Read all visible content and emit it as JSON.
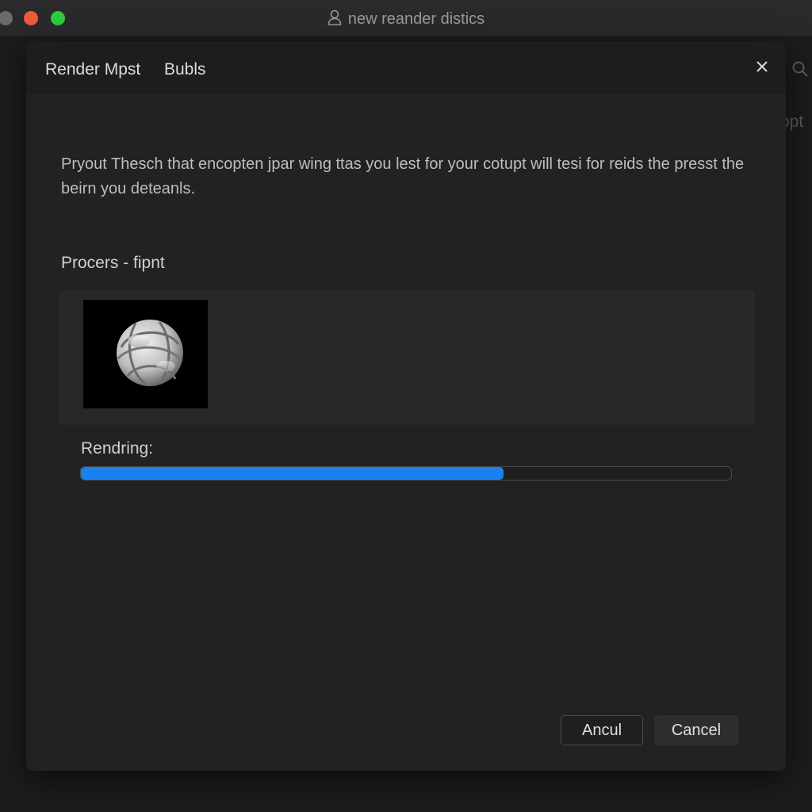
{
  "window": {
    "title": "new reander distics",
    "traffic_colors": {
      "close": "#6b6b6d",
      "minimize": "#f05a3c",
      "maximize": "#2ecc40"
    }
  },
  "background": {
    "partial_text": "opt"
  },
  "dialog": {
    "tabs": [
      {
        "label": "Render Mpst"
      },
      {
        "label": "Bubls"
      }
    ],
    "description": "Pryout Thesch that encopten jpar wing ttas you lest for your cotupt will tesi for reids the presst the beirn you deteanls.",
    "section_label": "Procers - fipnt",
    "progress": {
      "label": "Rendring:",
      "value": 0.65,
      "color": "#1a82f0"
    },
    "buttons": {
      "secondary_label": "Ancul",
      "primary_label": "Cancel"
    }
  }
}
